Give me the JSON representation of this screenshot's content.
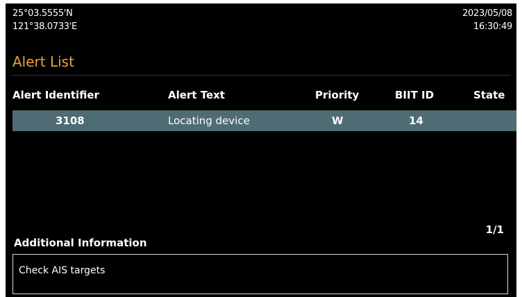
{
  "position": {
    "latitude": "25°03.5555'N",
    "longitude": "121°38.0733'E"
  },
  "datetime": {
    "date": "2023/05/08",
    "time": "16:30:49"
  },
  "title": "Alert List",
  "table": {
    "headers": [
      "Alert Identifier",
      "Alert Text",
      "Priority",
      "BIIT ID",
      "State"
    ],
    "rows": [
      {
        "alert_identifier": "3108",
        "alert_text": "Locating device",
        "priority": "W",
        "biit_id": "14",
        "state": ""
      }
    ]
  },
  "page_indicator": "1/1",
  "additional_information": {
    "label": "Additional Information",
    "text": "Check AIS targets"
  },
  "colors": {
    "title": "#e8a33c",
    "selected_row": "#4f6b73",
    "background": "#000000"
  }
}
